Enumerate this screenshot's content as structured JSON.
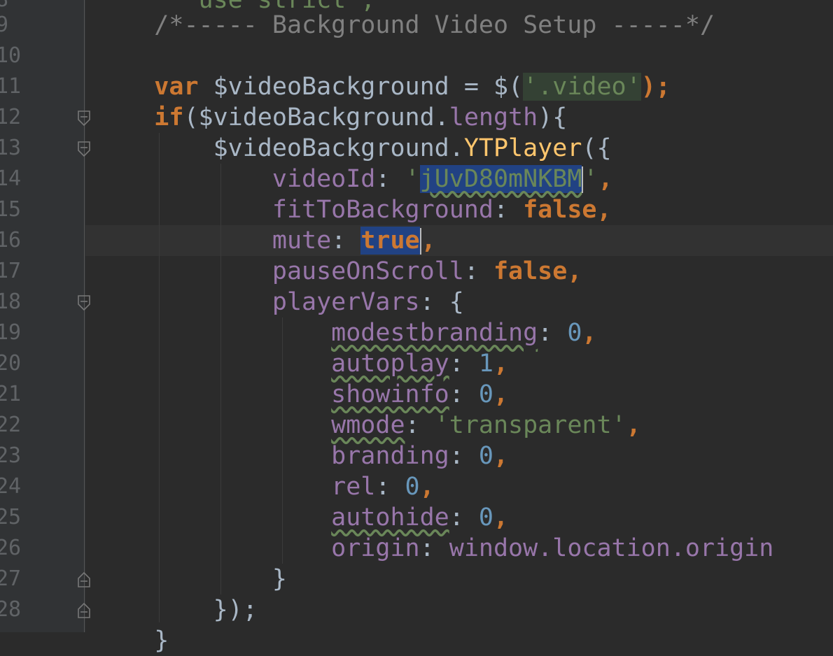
{
  "editor": {
    "partial_top_text": "'use strict';",
    "lines": [
      {
        "no": "9",
        "comment": "/*----- Background Video Setup -----*/"
      },
      {
        "no": "10"
      },
      {
        "no": "11",
        "kw": "var",
        "name": "$videoBackground",
        "op": " = $(",
        "str": "'.video'",
        "end": ");"
      },
      {
        "no": "12",
        "kw": "if",
        "open": "($videoBackground.",
        "prop": "length",
        "close": "){"
      },
      {
        "no": "13",
        "obj": "$videoBackground.",
        "fn": "YTPlayer",
        "open": "({"
      },
      {
        "no": "14",
        "key": "videoId",
        "value": "jUvD80mNKBM"
      },
      {
        "no": "15",
        "key": "fitToBackground",
        "value": "false"
      },
      {
        "no": "16",
        "key": "mute",
        "value": "true"
      },
      {
        "no": "17",
        "key": "pauseOnScroll",
        "value": "false"
      },
      {
        "no": "18",
        "key": "playerVars",
        "value": "{"
      },
      {
        "no": "19",
        "key": "modestbranding",
        "value": "0"
      },
      {
        "no": "20",
        "key": "autoplay",
        "value": "1"
      },
      {
        "no": "21",
        "key": "showinfo",
        "value": "0"
      },
      {
        "no": "22",
        "key": "wmode",
        "value": "'transparent'"
      },
      {
        "no": "23",
        "key": "branding",
        "value": "0"
      },
      {
        "no": "24",
        "key": "rel",
        "value": "0"
      },
      {
        "no": "25",
        "key": "autohide",
        "value": "0"
      },
      {
        "no": "26",
        "key": "origin",
        "value": "window.location.origin"
      },
      {
        "no": "27",
        "text": "}"
      },
      {
        "no": "28",
        "text": "});"
      }
    ]
  },
  "colors": {
    "background": "#2b2b2b",
    "keyword": "#cc7832",
    "string": "#6a8759",
    "number": "#6897bb",
    "property": "#9876aa",
    "function": "#ffc66d",
    "comment": "#808080",
    "selection": "#214283"
  }
}
